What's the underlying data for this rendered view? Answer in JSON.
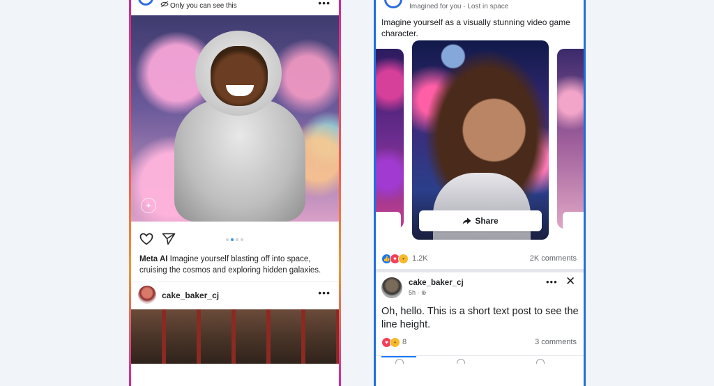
{
  "instagram": {
    "visibility_note": "Only you can see this",
    "more_glyph": "•••",
    "caption_author": "Meta AI",
    "caption_text": " Imagine yourself blasting off into space, cruising the cosmos and exploring hidden galaxies.",
    "carousel_pages": 4,
    "carousel_active": 1,
    "next_post_username": "cake_baker_cj"
  },
  "facebook": {
    "imagined_meta": "Imagined for you · Lost in space",
    "prompt": "Imagine yourself as a visually stunning video game character.",
    "share_label": "Share",
    "reaction_count": "1.2K",
    "comment_count": "2K comments",
    "post_username": "cake_baker_cj",
    "post_time": "5h ·",
    "post_text": "Oh, hello. This is a short text post to see the line height.",
    "post_reaction_count": "8",
    "post_comment_count": "3 comments",
    "close_glyph": "✕",
    "more_glyph": "•••"
  },
  "colors": {
    "facebook_blue": "#1877f2",
    "instagram_gradient": [
      "#d6249f",
      "#fd5949",
      "#f09433"
    ],
    "background": "#f1f4f8"
  }
}
